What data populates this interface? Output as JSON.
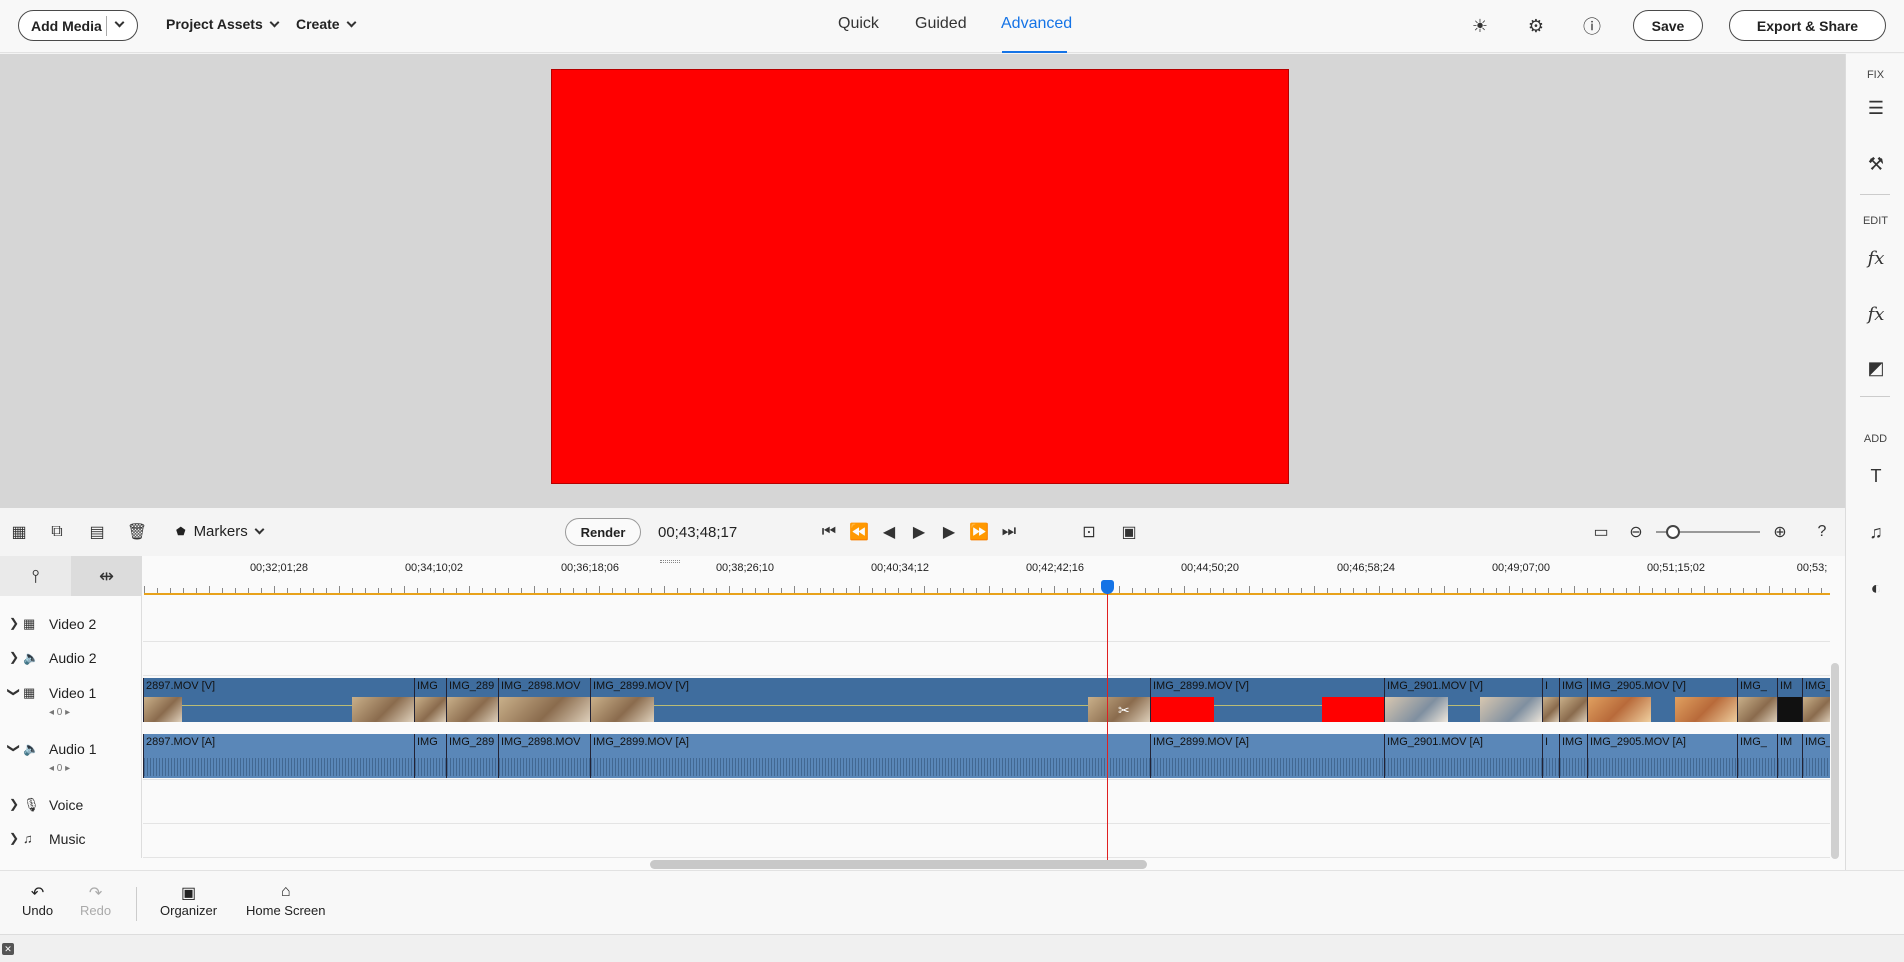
{
  "header": {
    "add_media": "Add Media",
    "project_assets": "Project Assets",
    "create": "Create",
    "tabs": [
      "Quick",
      "Guided",
      "Advanced"
    ],
    "active_tab": "Advanced",
    "save": "Save",
    "export_share": "Export & Share",
    "icons": [
      "brightness-icon",
      "settings-gear-icon",
      "info-icon"
    ]
  },
  "right_panel": {
    "sections": [
      "FIX",
      "EDIT",
      "ADD"
    ],
    "icons": [
      "adjustments-icon",
      "tools-icon",
      "effects-fx-icon",
      "applied-effects-fx-icon",
      "color-icon",
      "titles-icon",
      "music-icon",
      "graphics-icon"
    ]
  },
  "toolbar": {
    "markers": "Markers",
    "render": "Render",
    "timecode": "00;43;48;17"
  },
  "timeline": {
    "ruler_labels": [
      "00;32;01;28",
      "00;34;10;02",
      "00;36;18;06",
      "00;38;26;10",
      "00;40;34;12",
      "00;42;42;16",
      "00;44;50;20",
      "00;46;58;24",
      "00;49;07;00",
      "00;51;15;02",
      "00;53;"
    ],
    "tracks": [
      {
        "name": "Video 2",
        "type": "video"
      },
      {
        "name": "Audio 2",
        "type": "audio"
      },
      {
        "name": "Video 1",
        "type": "video",
        "sub": "◂ 0 ▸"
      },
      {
        "name": "Audio 1",
        "type": "audio",
        "sub": "◂ 0 ▸"
      },
      {
        "name": "Voice",
        "type": "voice"
      },
      {
        "name": "Music",
        "type": "music"
      }
    ],
    "video_clips": [
      "2897.MOV [V]",
      "IMG",
      "IMG_289",
      "IMG_2898.MOV",
      "IMG_2899.MOV [V]",
      "IMG_2899.MOV [V]",
      "IMG_2901.MOV [V]",
      "I",
      "IMG",
      "IMG_2905.MOV [V]",
      "IMG_",
      "IM",
      "IMG_"
    ],
    "audio_clips": [
      "2897.MOV [A]",
      "IMG",
      "IMG_289",
      "IMG_2898.MOV",
      "IMG_2899.MOV [A]",
      "IMG_2899.MOV [A]",
      "IMG_2901.MOV [A]",
      "I",
      "IMG",
      "IMG_2905.MOV [A]",
      "IMG_",
      "IM",
      "IMG_"
    ]
  },
  "bottom": {
    "undo": "Undo",
    "redo": "Redo",
    "organizer": "Organizer",
    "home_screen": "Home Screen"
  },
  "colors": {
    "accent": "#1473e6",
    "preview": "#ff0000",
    "clip": "#3f6d9e",
    "playhead": "#e02020"
  }
}
